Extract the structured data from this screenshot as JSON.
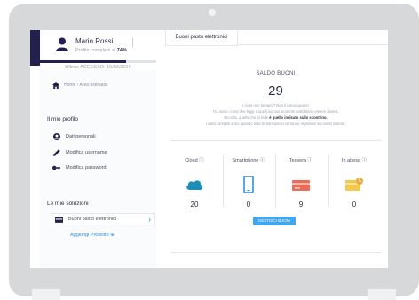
{
  "sidebar": {
    "user_name": "Mario Rossi",
    "profile_prefix": "Profilo completo al",
    "profile_percent": "74%",
    "profile_progress": 0.74,
    "last_access": "Ultimo ACCESSO: 15/02/2019",
    "breadcrumb": "Home › Area riservata",
    "section_profile": "Il mio profilo",
    "profile_items": [
      "Dati personali",
      "Modifica username",
      "Modifica password"
    ],
    "section_solutions": "Le mie soluzioni",
    "solution_item": "Buoni pasto elettronici",
    "add_product": "Aggiungi Prodotto ⊕"
  },
  "main": {
    "tab": "Buoni pasto elettronici",
    "saldo_label": "SALDO BUONI",
    "saldo_value": "29",
    "info_line1": "I conti non tornano? Non ti preoccupare!",
    "info_line2": "Tra oscio i conti che leggi a quelli sui tuoi scontrini potrebbero essere diversi.",
    "info_line3_prefix": "Ricorda, quello che fa fede ",
    "info_line3_bold": "è quello indicato sullo scontrino.",
    "info_line4": "I saldi contabili sono quando tutte le transazioni verranno registrate sui nostri sistemi.",
    "stats": [
      {
        "label": "Cloud ⓘ",
        "value": "20",
        "icon": "cloud-icon",
        "color": "#1c8fb8"
      },
      {
        "label": "Smartphone ⓘ",
        "value": "0",
        "icon": "smartphone-icon",
        "color": "#2f8fe3"
      },
      {
        "label": "Tessera ⓘ",
        "value": "9",
        "icon": "card-icon",
        "color": "#ee6b57"
      },
      {
        "label": "In attesa ⓘ",
        "value": "0",
        "icon": "pending-icon",
        "color": "#f2c94c"
      }
    ],
    "manage_button": "GESTISCI BUONI"
  },
  "colors": {
    "navy": "#24204e",
    "accent_blue": "#43a5ec"
  }
}
